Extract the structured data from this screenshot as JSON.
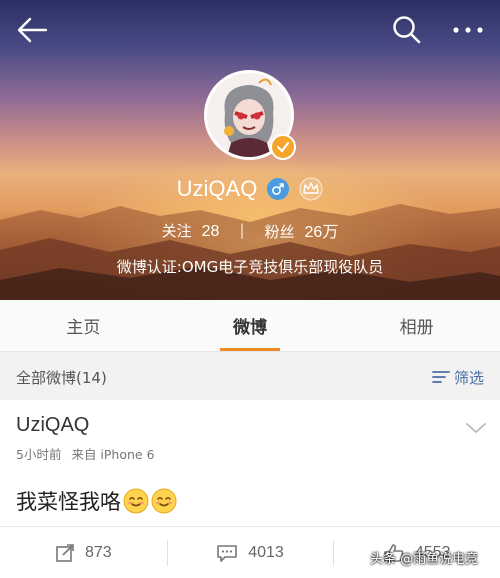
{
  "header": {
    "back_icon": "back-arrow-icon",
    "search_icon": "search-icon",
    "more_icon": "more-dots-icon"
  },
  "profile": {
    "username": "UziQAQ",
    "gender_icon": "male-icon",
    "member_icon": "crown-icon",
    "following_label": "关注",
    "following_count": "28",
    "followers_label": "粉丝",
    "followers_count": "26万",
    "verification": "微博认证:OMG电子竞技俱乐部现役队员",
    "verified_badge_color": "#f4a52a"
  },
  "tabs": [
    {
      "label": "主页",
      "active": false
    },
    {
      "label": "微博",
      "active": true
    },
    {
      "label": "相册",
      "active": false
    }
  ],
  "accent_color": "#f08a24",
  "filter": {
    "all_posts": "全部微博(14)",
    "filter_label": "筛选"
  },
  "post": {
    "author": "UziQAQ",
    "time": "5小时前",
    "source": "来自 iPhone 6",
    "text": "我菜怪我咯",
    "emojis": [
      "smile-emoji",
      "smile-emoji"
    ],
    "repost_count": "873",
    "comment_count": "4013",
    "like_count": "4553"
  },
  "watermark": "头条 @雨鱼说电竞"
}
